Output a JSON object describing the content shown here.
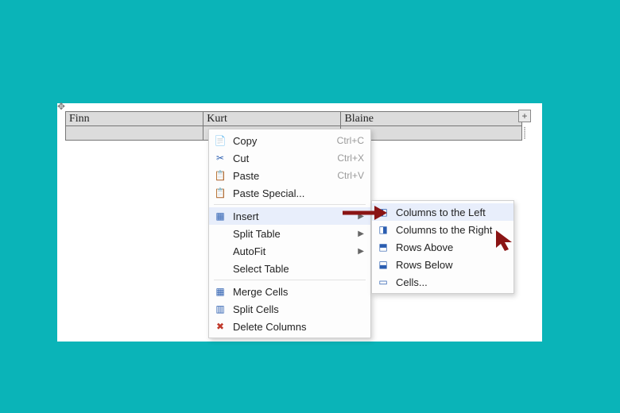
{
  "table": {
    "cells": [
      "Finn",
      "Kurt",
      "Blaine"
    ]
  },
  "context_menu": {
    "copy": {
      "label": "Copy",
      "shortcut": "Ctrl+C"
    },
    "cut": {
      "label": "Cut",
      "shortcut": "Ctrl+X"
    },
    "paste": {
      "label": "Paste",
      "shortcut": "Ctrl+V"
    },
    "paste_special": {
      "label": "Paste Special..."
    },
    "insert": {
      "label": "Insert"
    },
    "split_table": {
      "label": "Split Table"
    },
    "autofit": {
      "label": "AutoFit"
    },
    "select_table": {
      "label": "Select Table"
    },
    "merge_cells": {
      "label": "Merge Cells"
    },
    "split_cells": {
      "label": "Split Cells"
    },
    "delete_columns": {
      "label": "Delete Columns"
    }
  },
  "insert_submenu": {
    "cols_left": {
      "label": "Columns to the Left"
    },
    "cols_right": {
      "label": "Columns to the Right"
    },
    "rows_above": {
      "label": "Rows Above"
    },
    "rows_below": {
      "label": "Rows Below"
    },
    "cells": {
      "label": "Cells..."
    }
  },
  "icons": {
    "copy": "📄",
    "cut": "✂",
    "paste": "📋",
    "paste_special": "📋",
    "insert": "▦",
    "merge": "▦",
    "split": "▥",
    "delete_cols": "✖",
    "cols_left": "◧",
    "cols_right": "◨",
    "rows_above": "⬒",
    "rows_below": "⬓",
    "cells": "▭",
    "move": "✥",
    "add": "+"
  },
  "colors": {
    "page_bg": "#0ab4b8",
    "menu_highlight": "#e8eefb",
    "annotation": "#8a1414"
  }
}
